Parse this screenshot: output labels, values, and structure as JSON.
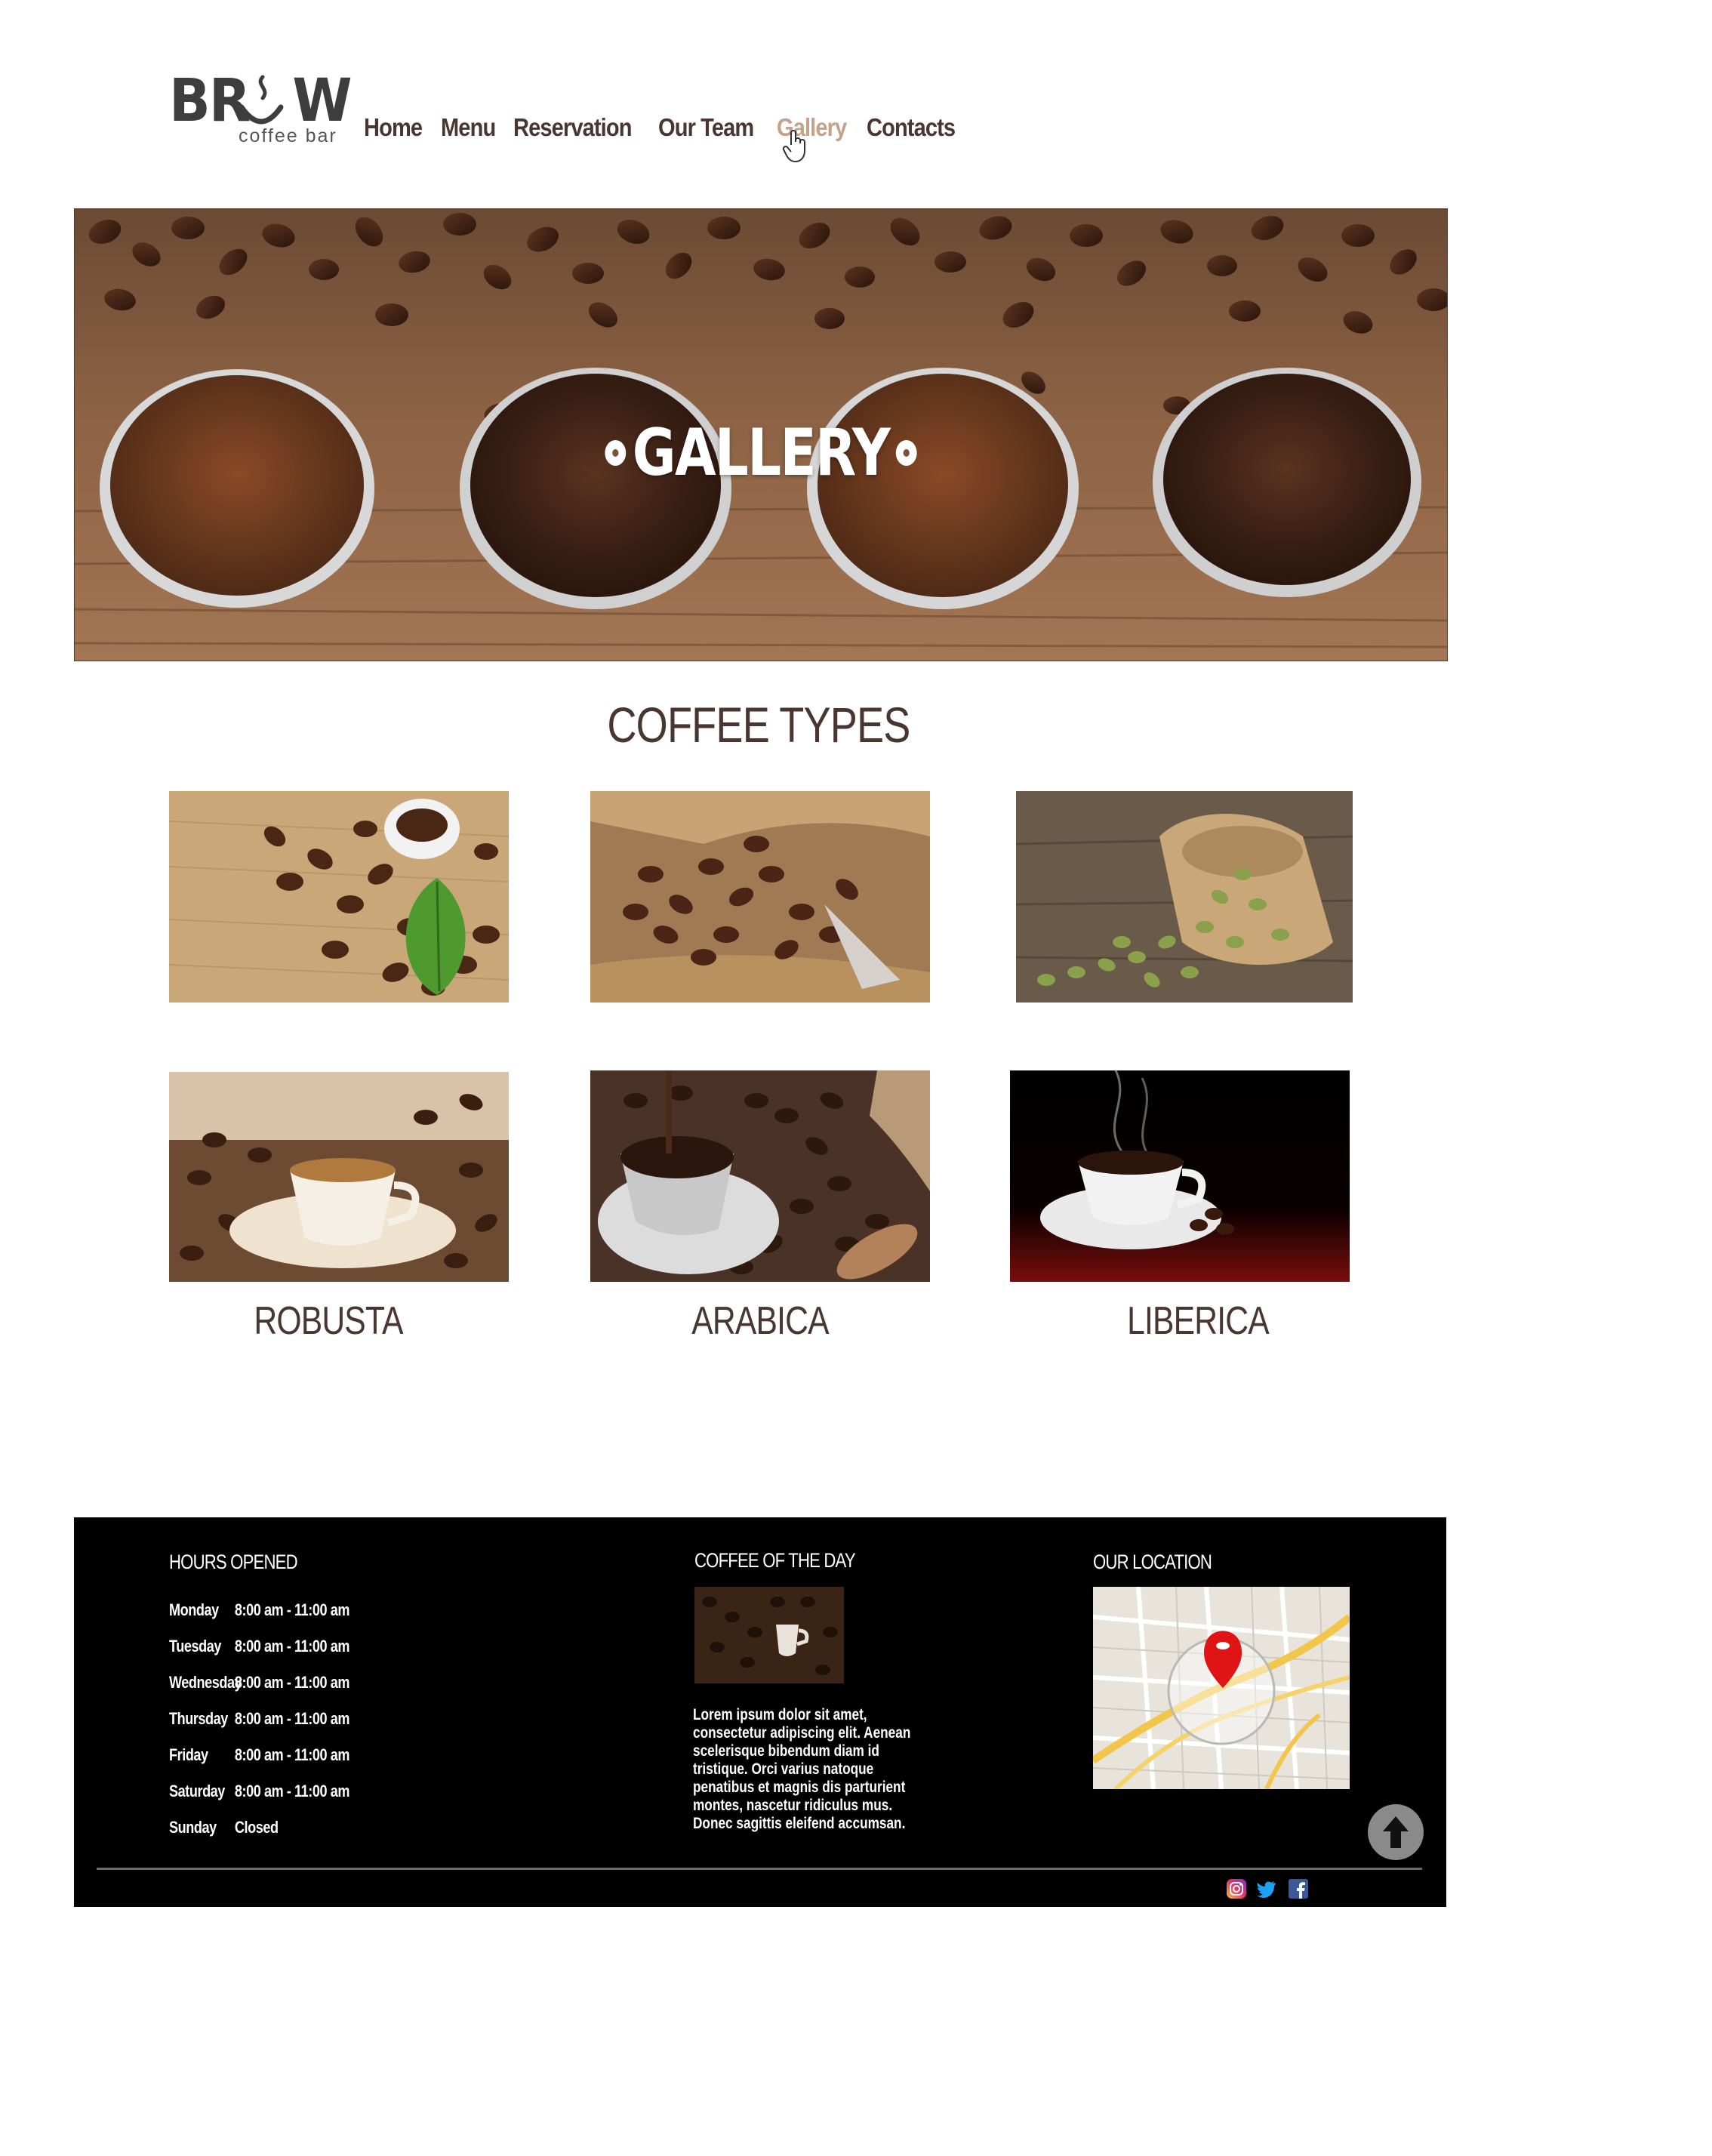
{
  "header": {
    "logo_word": "BR W",
    "logo_sub": "coffee bar",
    "nav": [
      "Home",
      "Menu",
      "Reservation",
      "Our Team",
      "Gallery",
      "Contacts"
    ],
    "active_nav": "Gallery"
  },
  "hero": {
    "title": "GALLERY"
  },
  "coffee_types": {
    "title": "COFFEE TYPES",
    "labels": [
      "ROBUSTA",
      "ARABICA",
      "LIBERICA"
    ]
  },
  "footer": {
    "hours": {
      "heading": "HOURS OPENED",
      "rows": [
        {
          "day": "Monday",
          "time": "8:00 am - 11:00 am"
        },
        {
          "day": "Tuesday",
          "time": "8:00 am - 11:00 am"
        },
        {
          "day": "Wednesday",
          "time": "8:00 am - 11:00 am"
        },
        {
          "day": "Thursday",
          "time": "8:00 am - 11:00 am"
        },
        {
          "day": "Friday",
          "time": "8:00 am - 11:00 am"
        },
        {
          "day": "Saturday",
          "time": "8:00 am - 11:00 am"
        },
        {
          "day": "Sunday",
          "time": "Closed"
        }
      ]
    },
    "coffee_of_day": {
      "heading": "COFFEE OF THE DAY",
      "text": "Lorem ipsum dolor sit amet, consectetur adipiscing elit. Aenean scelerisque bibendum diam id tristique. Orci varius natoque penatibus et magnis dis parturient montes, nascetur ridiculus mus. Donec sagittis eleifend accumsan."
    },
    "location": {
      "heading": "OUR LOCATION"
    },
    "social_icons": [
      "instagram-icon",
      "twitter-icon",
      "facebook-icon"
    ]
  },
  "colors": {
    "nav_text": "#4a3630",
    "nav_active": "#c4a189",
    "footer_bg": "#000000"
  }
}
